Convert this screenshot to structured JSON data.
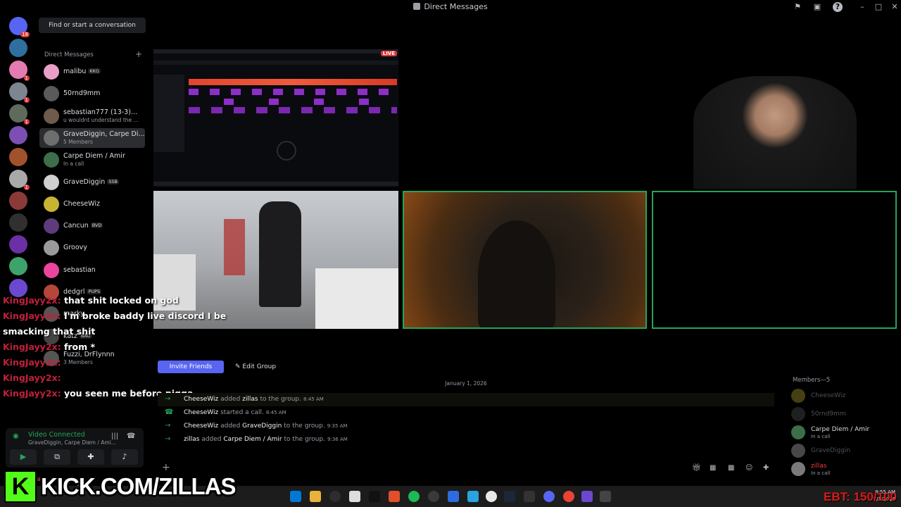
{
  "window": {
    "title": "Direct Messages"
  },
  "rail": {
    "home_badge": "18",
    "servers": [
      {
        "color": "#5865f2",
        "badge": "18"
      },
      {
        "color": "#2f6f9f",
        "badge": ""
      },
      {
        "color": "#e57bb0",
        "badge": "1"
      },
      {
        "color": "#7d8590",
        "badge": "1"
      },
      {
        "color": "#5e6a5c",
        "badge": "1"
      },
      {
        "color": "#7b4fb3",
        "badge": ""
      },
      {
        "color": "#a0522d",
        "badge": ""
      },
      {
        "color": "#a9a9a9",
        "badge": "1"
      },
      {
        "color": "#8b3a3a",
        "badge": ""
      },
      {
        "color": "#303030",
        "badge": ""
      },
      {
        "color": "#6b2fa6",
        "badge": ""
      },
      {
        "color": "#3da36a",
        "badge": ""
      },
      {
        "color": "#6b48cf",
        "badge": ""
      }
    ]
  },
  "sidebar": {
    "find_button": "Find or start a conversation",
    "dm_header": "Direct Messages",
    "dm_plus": "+",
    "items": [
      {
        "name": "malibu",
        "tag": "KKG",
        "sub": "",
        "color": "#e8a0c8"
      },
      {
        "name": "50rnd9mm",
        "tag": "",
        "sub": "",
        "color": "#5a5a5a"
      },
      {
        "name": "sebastian777 (13-3)...",
        "tag": "",
        "sub": "u wouldnt understand the ...",
        "color": "#6f5b4a"
      },
      {
        "name": "GraveDiggin, Carpe Di...",
        "tag": "",
        "sub": "5 Members",
        "color": "#6e6e6e"
      },
      {
        "name": "Carpe Diem / Amir",
        "tag": "",
        "sub": "In a call",
        "color": "#3c6e4a"
      },
      {
        "name": "GraveDiggin",
        "tag": "SSB",
        "sub": "",
        "color": "#cfcfcf"
      },
      {
        "name": "CheeseWiz",
        "tag": "",
        "sub": "",
        "color": "#c8b432"
      },
      {
        "name": "Cancun",
        "tag": "BVD",
        "sub": "",
        "color": "#5e3b7a"
      },
      {
        "name": "Groovy",
        "tag": "",
        "sub": "",
        "color": "#9a9a9a"
      },
      {
        "name": "sebastian",
        "tag": "",
        "sub": "",
        "color": "#eb459e"
      },
      {
        "name": "dedgrl",
        "tag": "PUPS",
        "sub": "",
        "color": "#b5473a"
      },
      {
        "name": "marky",
        "tag": "",
        "sub": "",
        "color": "#555"
      },
      {
        "name": "katz",
        "tag": "BAU",
        "sub": "",
        "color": "#444"
      },
      {
        "name": "Fuzzi, DrFlynnn",
        "tag": "",
        "sub": "3 Members",
        "color": "#555"
      }
    ]
  },
  "voice": {
    "status": "Video Connected",
    "channel": "GraveDiggin, Carpe Diem / Ami..."
  },
  "user": {
    "name": "zillas"
  },
  "stream_overlay": {
    "live_label": "LIVE",
    "messages": [
      {
        "user": "KingJayy2x:",
        "text": "that shit locked on god"
      },
      {
        "user": "KingJayy2x:",
        "text": "I'm broke baddy live discord I be"
      },
      {
        "user": "",
        "text": "smacking that shit"
      },
      {
        "user": "KingJayy2x:",
        "text": "from *"
      },
      {
        "user": "KingJayy2x:",
        "text": ""
      },
      {
        "user": "KingJayy2x:",
        "text": ""
      },
      {
        "user": "KingJayy2x:",
        "text": "you seen me before nigga"
      }
    ]
  },
  "chat": {
    "invite_button": "Invite Friends",
    "edit_button": "Edit Group",
    "date_divider": "January 1, 2026",
    "events": [
      {
        "a": "CheeseWiz",
        "verb": "added",
        "b": "zillas",
        "rest": "to the group.",
        "time": "8:45 AM"
      },
      {
        "a": "CheeseWiz",
        "verb": "started a call.",
        "b": "",
        "rest": "",
        "time": "8:45 AM"
      },
      {
        "a": "CheeseWiz",
        "verb": "added",
        "b": "GraveDiggin",
        "rest": "to the group.",
        "time": "9:35 AM"
      },
      {
        "a": "zillas",
        "verb": "added",
        "b": "Carpe Diem / Amir",
        "rest": "to the group.",
        "time": "9:36 AM"
      }
    ]
  },
  "members": {
    "header": "Members—5",
    "list": [
      {
        "name": "CheeseWiz",
        "status": "",
        "dim": true,
        "color": "#c8b432",
        "name_color": "#4e5058"
      },
      {
        "name": "50rnd9mm",
        "status": "",
        "dim": true,
        "color": "#5a5a5a",
        "name_color": "#4e5058"
      },
      {
        "name": "Carpe Diem / Amir",
        "status": "In a call",
        "dim": false,
        "color": "#3c6e4a",
        "name_color": "#dbdee1"
      },
      {
        "name": "GraveDiggin",
        "status": "",
        "dim": true,
        "color": "#cfcfcf",
        "name_color": "#4e5058"
      },
      {
        "name": "zillas",
        "status": "In a call",
        "dim": false,
        "color": "#7a7a7a",
        "name_color": "#f23f43"
      }
    ]
  },
  "overlay": {
    "kick_logo": "K",
    "kick_url": "KICK.COM/ZILLAS",
    "goal_text": "EBT: 150/100"
  },
  "taskbar": {
    "time": "9:55 AM",
    "date": "1/1/2026"
  }
}
